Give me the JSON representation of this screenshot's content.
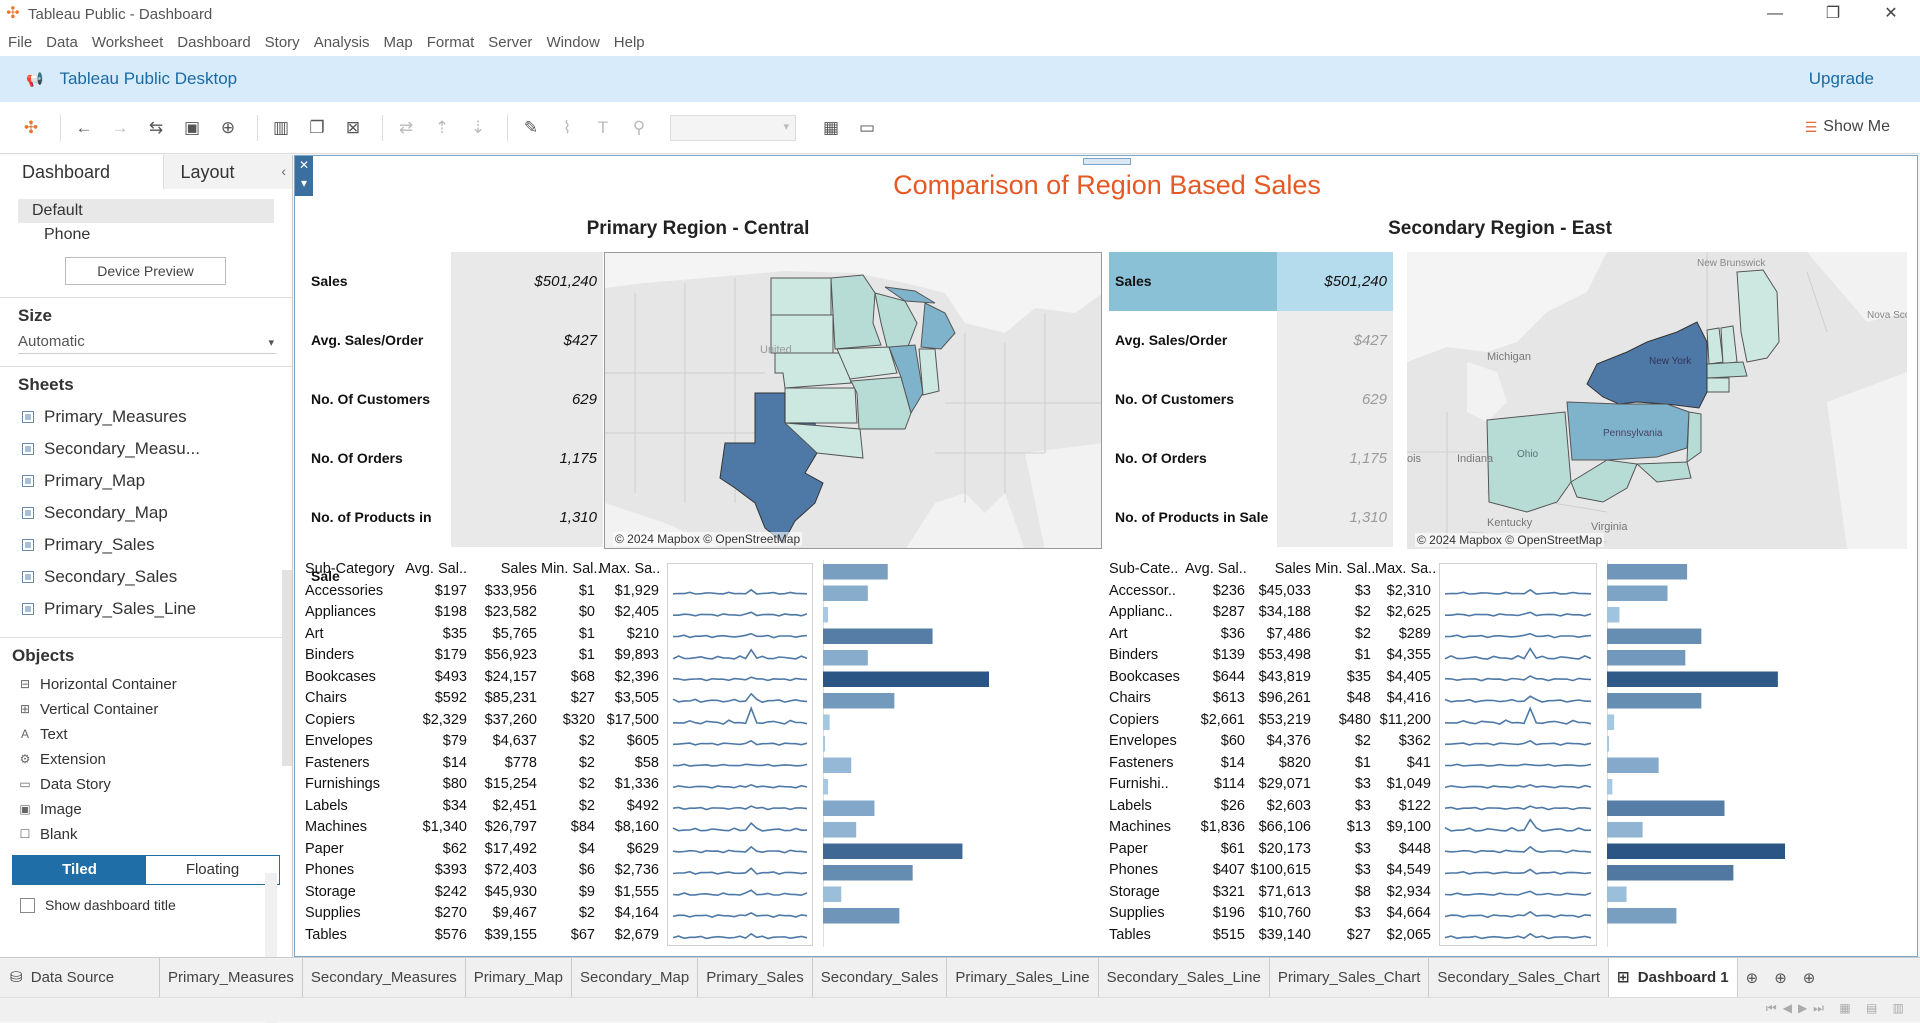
{
  "window": {
    "title": "Tableau Public - Dashboard",
    "controls": [
      "—",
      "❐",
      "✕"
    ]
  },
  "menu": [
    "File",
    "Data",
    "Worksheet",
    "Dashboard",
    "Story",
    "Analysis",
    "Map",
    "Format",
    "Server",
    "Window",
    "Help"
  ],
  "banner": {
    "title": "Tableau Public Desktop",
    "upgrade": "Upgrade"
  },
  "toolbar": {
    "show_me": "Show Me"
  },
  "left_panel": {
    "tabs": [
      "Dashboard",
      "Layout"
    ],
    "devices": [
      "Default",
      "Phone"
    ],
    "device_preview": "Device Preview",
    "size_heading": "Size",
    "size_value": "Automatic",
    "sheets_heading": "Sheets",
    "sheets": [
      "Primary_Measures",
      "Secondary_Measu...",
      "Primary_Map",
      "Secondary_Map",
      "Primary_Sales",
      "Secondary_Sales",
      "Primary_Sales_Line"
    ],
    "objects_heading": "Objects",
    "objects": [
      {
        "label": "Horizontal Container",
        "icon": "horizontal-container-icon",
        "glyph": "⊟"
      },
      {
        "label": "Vertical Container",
        "icon": "vertical-container-icon",
        "glyph": "⊞"
      },
      {
        "label": "Text",
        "icon": "text-icon",
        "glyph": "A"
      },
      {
        "label": "Extension",
        "icon": "extension-icon",
        "glyph": "⚙"
      },
      {
        "label": "Data Story",
        "icon": "data-story-icon",
        "glyph": "▭"
      },
      {
        "label": "Image",
        "icon": "image-icon",
        "glyph": "▣"
      },
      {
        "label": "Blank",
        "icon": "blank-icon",
        "glyph": "☐"
      }
    ],
    "tiled": "Tiled",
    "floating": "Floating",
    "show_title": "Show dashboard title"
  },
  "dashboard": {
    "title": "Comparison of Region Based Sales",
    "primary": {
      "title": "Primary Region - Central",
      "kpis": [
        {
          "label": "Sales",
          "value": "$501,240"
        },
        {
          "label": "Avg. Sales/Order",
          "value": "$427"
        },
        {
          "label": "No. Of Customers",
          "value": "629"
        },
        {
          "label": "No. Of Orders",
          "value": "1,175"
        },
        {
          "label": "No. of Products in Sale",
          "value": "1,310"
        }
      ],
      "map_attribution": "© 2024 Mapbox © OpenStreetMap",
      "map_labels": [
        "United"
      ],
      "table": {
        "headers": [
          "Sub-Category",
          "Avg. Sal..",
          "Sales",
          "Min. Sal..",
          "Max. Sa.."
        ],
        "rows": [
          [
            "Accessories",
            "$197",
            "$33,956",
            "$1",
            "$1,929"
          ],
          [
            "Appliances",
            "$198",
            "$23,582",
            "$0",
            "$2,405"
          ],
          [
            "Art",
            "$35",
            "$5,765",
            "$1",
            "$210"
          ],
          [
            "Binders",
            "$179",
            "$56,923",
            "$1",
            "$9,893"
          ],
          [
            "Bookcases",
            "$493",
            "$24,157",
            "$68",
            "$2,396"
          ],
          [
            "Chairs",
            "$592",
            "$85,231",
            "$27",
            "$3,505"
          ],
          [
            "Copiers",
            "$2,329",
            "$37,260",
            "$320",
            "$17,500"
          ],
          [
            "Envelopes",
            "$79",
            "$4,637",
            "$2",
            "$605"
          ],
          [
            "Fasteners",
            "$14",
            "$778",
            "$2",
            "$58"
          ],
          [
            "Furnishings",
            "$80",
            "$15,254",
            "$2",
            "$1,336"
          ],
          [
            "Labels",
            "$34",
            "$2,451",
            "$2",
            "$492"
          ],
          [
            "Machines",
            "$1,340",
            "$26,797",
            "$84",
            "$8,160"
          ],
          [
            "Paper",
            "$62",
            "$17,492",
            "$4",
            "$629"
          ],
          [
            "Phones",
            "$393",
            "$72,403",
            "$6",
            "$2,736"
          ],
          [
            "Storage",
            "$242",
            "$45,930",
            "$9",
            "$1,555"
          ],
          [
            "Supplies",
            "$270",
            "$9,467",
            "$2",
            "$4,164"
          ],
          [
            "Tables",
            "$576",
            "$39,155",
            "$67",
            "$2,679"
          ]
        ],
        "bar_values": [
          0.39,
          0.27,
          0.03,
          0.66,
          0.27,
          1.0,
          0.43,
          0.04,
          0.01,
          0.17,
          0.03,
          0.31,
          0.2,
          0.84,
          0.54,
          0.11,
          0.46
        ],
        "spark_peaks": [
          0.2,
          0.2,
          0.3,
          0.7,
          0.2,
          0.6,
          1.0,
          0.2,
          0.1,
          0.2,
          0.2,
          0.6,
          0.3,
          0.3,
          0.4,
          0.3,
          0.3
        ]
      }
    },
    "secondary": {
      "title": "Secondary Region - East",
      "kpis": [
        {
          "label": "Sales",
          "value": "$501,240"
        },
        {
          "label": "Avg. Sales/Order",
          "value": "$427"
        },
        {
          "label": "No. Of Customers",
          "value": "629"
        },
        {
          "label": "No. Of Orders",
          "value": "1,175"
        },
        {
          "label": "No. of Products in Sale",
          "value": "1,310"
        }
      ],
      "map_attribution": "© 2024 Mapbox © OpenStreetMap",
      "map_labels": [
        "New Brunswick",
        "Nova Sco",
        "Michigan",
        "New York",
        "Pennsylvania",
        "Ohio",
        "Indiana",
        "Kentucky",
        "Virginia",
        "ois"
      ],
      "table": {
        "headers": [
          "Sub-Cate..",
          "Avg. Sal..",
          "Sales",
          "Min. Sal..",
          "Max. Sa.."
        ],
        "rows": [
          [
            "Accessor..",
            "$236",
            "$45,033",
            "$3",
            "$2,310"
          ],
          [
            "Applianc..",
            "$287",
            "$34,188",
            "$2",
            "$2,625"
          ],
          [
            "Art",
            "$36",
            "$7,486",
            "$2",
            "$289"
          ],
          [
            "Binders",
            "$139",
            "$53,498",
            "$1",
            "$4,355"
          ],
          [
            "Bookcases",
            "$644",
            "$43,819",
            "$35",
            "$4,405"
          ],
          [
            "Chairs",
            "$613",
            "$96,261",
            "$48",
            "$4,416"
          ],
          [
            "Copiers",
            "$2,661",
            "$53,219",
            "$480",
            "$11,200"
          ],
          [
            "Envelopes",
            "$60",
            "$4,376",
            "$2",
            "$362"
          ],
          [
            "Fasteners",
            "$14",
            "$820",
            "$1",
            "$41"
          ],
          [
            "Furnishi..",
            "$114",
            "$29,071",
            "$3",
            "$1,049"
          ],
          [
            "Labels",
            "$26",
            "$2,603",
            "$3",
            "$122"
          ],
          [
            "Machines",
            "$1,836",
            "$66,106",
            "$13",
            "$9,100"
          ],
          [
            "Paper",
            "$61",
            "$20,173",
            "$3",
            "$448"
          ],
          [
            "Phones",
            "$407",
            "$100,615",
            "$3",
            "$4,549"
          ],
          [
            "Storage",
            "$321",
            "$71,613",
            "$8",
            "$2,934"
          ],
          [
            "Supplies",
            "$196",
            "$10,760",
            "$3",
            "$4,664"
          ],
          [
            "Tables",
            "$515",
            "$39,140",
            "$27",
            "$2,065"
          ]
        ],
        "bar_values": [
          0.45,
          0.34,
          0.07,
          0.53,
          0.44,
          0.96,
          0.53,
          0.04,
          0.01,
          0.29,
          0.03,
          0.66,
          0.2,
          1.0,
          0.71,
          0.11,
          0.39
        ],
        "spark_peaks": [
          0.2,
          0.2,
          0.3,
          0.8,
          0.3,
          0.4,
          1.0,
          0.2,
          0.1,
          0.2,
          0.2,
          0.9,
          0.3,
          0.2,
          0.3,
          0.4,
          0.3
        ]
      }
    }
  },
  "sheet_tabs": [
    "Data Source",
    "Primary_Measures",
    "Secondary_Measures",
    "Primary_Map",
    "Secondary_Map",
    "Primary_Sales",
    "Secondary_Sales",
    "Primary_Sales_Line",
    "Secondary_Sales_Line",
    "Primary_Sales_Chart",
    "Secondary_Sales_Chart",
    "Dashboard 1"
  ],
  "colors": {
    "accent": "#e55a24",
    "bar_dark": "#2f5b8a",
    "bar_light": "#a9cce6",
    "tableau_blue": "#1f6ea8",
    "map_dark": "#4e79a7",
    "map_mid": "#7fb3cc",
    "map_light": "#cde8e0"
  }
}
